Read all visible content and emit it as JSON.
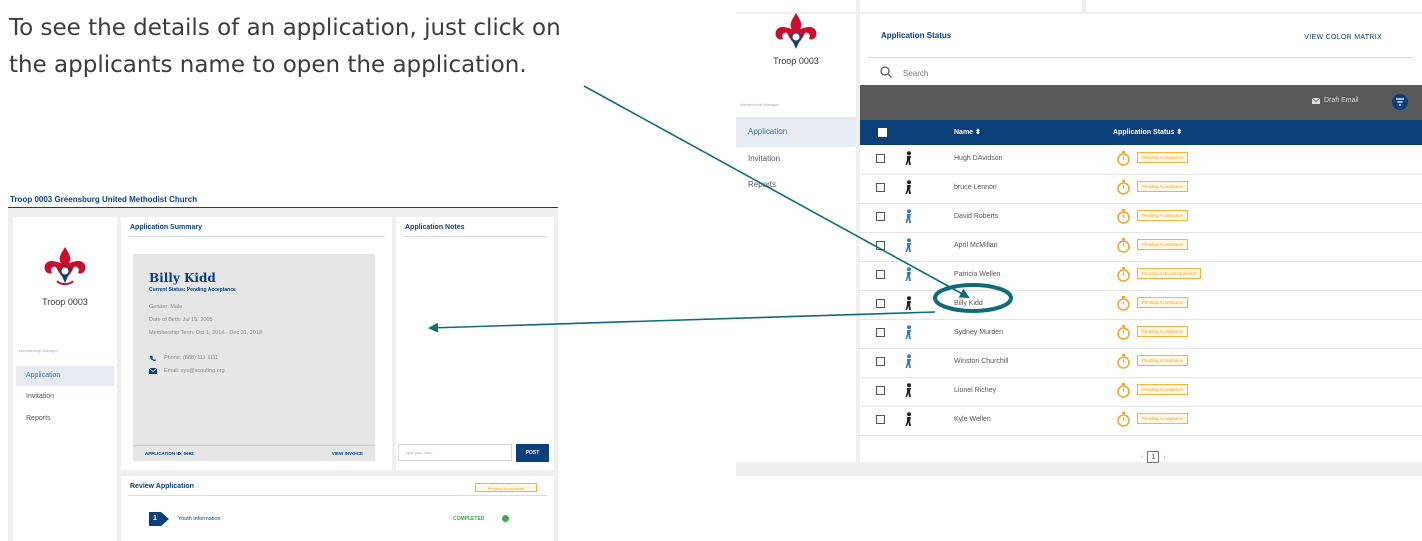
{
  "instruction": {
    "line1": "To see the details of an application, just click on",
    "line2": "the applicants name to open the application."
  },
  "left_screenshot": {
    "header_title": "Troop 0003 Greensburg United Methodist Church",
    "sidebar": {
      "troop": "Troop 0003",
      "section_label": "Membership Manager",
      "items": [
        {
          "label": "Application"
        },
        {
          "label": "Invitation"
        },
        {
          "label": "Reports"
        }
      ]
    },
    "summary": {
      "title": "Application Summary",
      "name": "Billy Kidd",
      "current_status": "Current Status: Pending Acceptance",
      "gender": "Gender: Male",
      "dob": "Date of Birth: Jul 15, 2005",
      "membership_term": "Membership Term: Oct 1, 2018 - Dec 31, 2018",
      "phone": "Phone: (888) 111 1111",
      "email": "Email: sys@scouting.org",
      "application_id": "APPLICATION ID: 5693",
      "view_invoice": "VIEW INVOICE"
    },
    "notes": {
      "title": "Application Notes",
      "input_placeholder": "Type your note...",
      "post_label": "POST"
    },
    "review": {
      "title": "Review Application",
      "badge": "Pending Acceptance",
      "step_number": "1",
      "step_label": "Youth information",
      "step_status": "COMPLETED"
    }
  },
  "right_screenshot": {
    "sidebar": {
      "troop": "Troop 0003",
      "section_label": "Membership Manager",
      "items": [
        {
          "label": "Application"
        },
        {
          "label": "Invitation"
        },
        {
          "label": "Reports"
        }
      ]
    },
    "title": "Application Status",
    "view_color_matrix": "VIEW COLOR MATRIX",
    "search_placeholder": "Search",
    "draft_email": "Draft Email",
    "columns": {
      "name": "Name",
      "status": "Application Status"
    },
    "rows": [
      {
        "name": "Hugh DAvidson",
        "status": "Pending Acceptance",
        "gender": "male"
      },
      {
        "name": "bruce Lennon",
        "status": "Pending Acceptance",
        "gender": "male"
      },
      {
        "name": "David Roberts",
        "status": "Pending Acceptance",
        "gender": "female"
      },
      {
        "name": "April McMillan",
        "status": "Pending Acceptance",
        "gender": "female"
      },
      {
        "name": "Patricia Wellen",
        "status": "Pending Acknowledgement",
        "gender": "female"
      },
      {
        "name": "Billy Kidd",
        "status": "Pending Acceptance",
        "gender": "male"
      },
      {
        "name": "Sydney Murden",
        "status": "Pending Acceptance",
        "gender": "female"
      },
      {
        "name": "Winston Churchill",
        "status": "Pending Acceptance",
        "gender": "female"
      },
      {
        "name": "Lionel Richey",
        "status": "Pending Acceptance",
        "gender": "male"
      },
      {
        "name": "Kyle Wellen",
        "status": "Pending Acceptance",
        "gender": "male"
      }
    ],
    "pager": {
      "current": "1"
    }
  },
  "colors": {
    "navy": "#0a3f7a",
    "annotation_teal": "#0f6b78",
    "pending_orange": "#f0a32b",
    "complete_green": "#38a54b"
  }
}
